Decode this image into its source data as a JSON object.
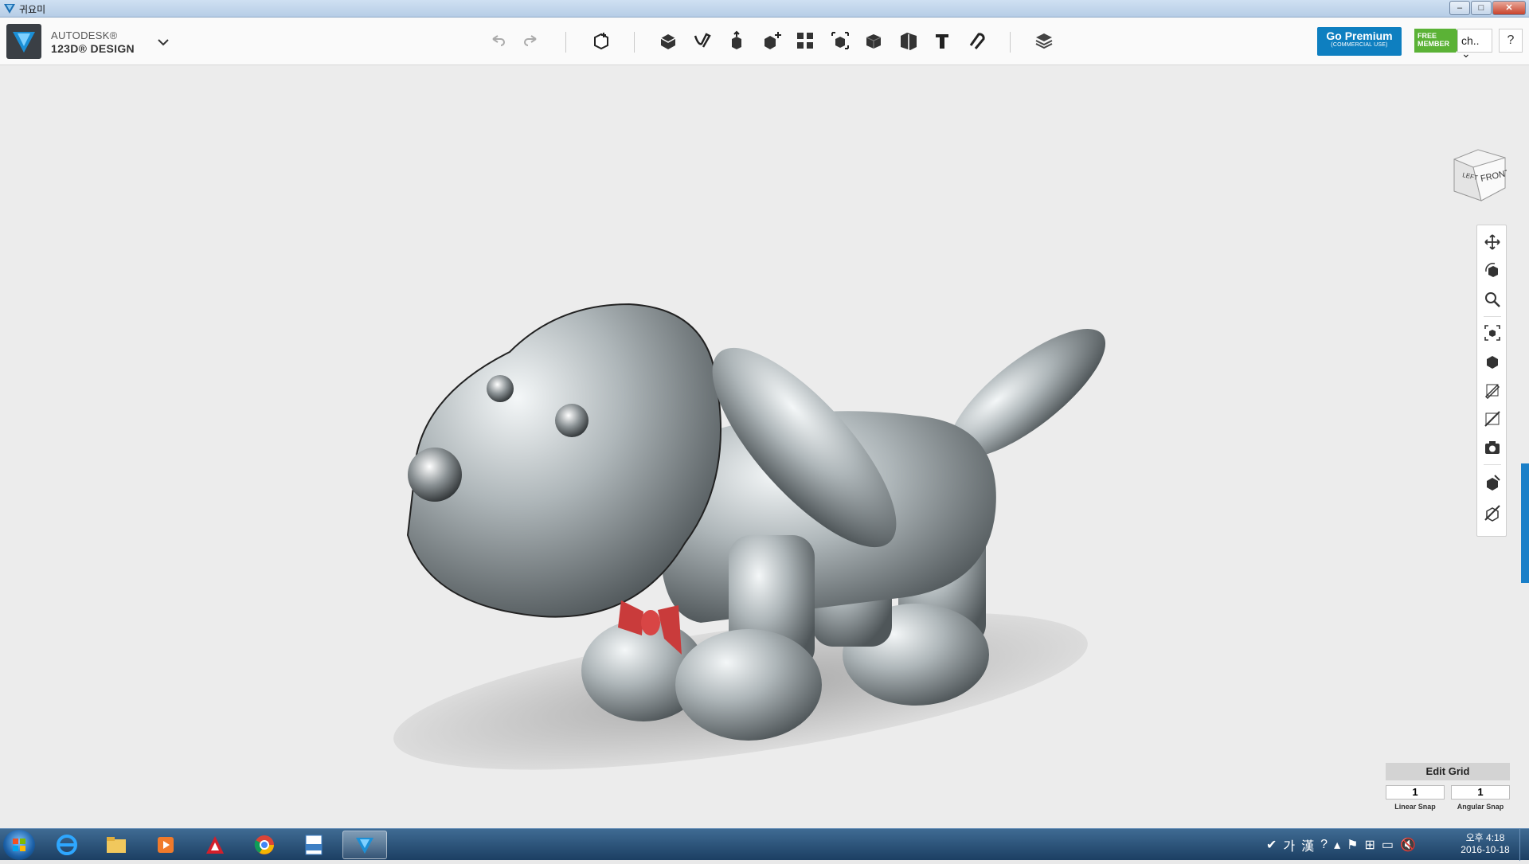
{
  "window": {
    "title": "귀요미",
    "min_label": "–",
    "max_label": "□",
    "close_label": "✕"
  },
  "app": {
    "brand_line1": "AUTODESK®",
    "brand_line2": "123D® DESIGN"
  },
  "toolbar": {
    "tools": [
      "undo-icon",
      "redo-icon",
      "primitives-icon",
      "sketch-icon",
      "construct-icon",
      "modify-icon",
      "pattern-icon",
      "group-icon",
      "combine-icon",
      "measure-icon",
      "text-icon",
      "snap-icon",
      "material-icon"
    ]
  },
  "premium": {
    "label": "Go Premium",
    "sublabel": "(COMMERCIAL USE)"
  },
  "member": {
    "badge_line1": "FREE",
    "badge_line2": "MEMBER",
    "user": "ch..",
    "chevron": "⌄"
  },
  "help": {
    "label": "?"
  },
  "viewcube": {
    "faces": [
      "LEFT",
      "FRONT"
    ]
  },
  "nav": {
    "items": [
      "pan-icon",
      "orbit-icon",
      "zoom-icon",
      "fit-icon",
      "views-icon",
      "visibility-icon",
      "hide-sketch-icon",
      "screenshot-icon",
      "material-display-icon",
      "outline-icon"
    ]
  },
  "grid": {
    "title": "Edit Grid",
    "linear_snap": "1",
    "angular_snap": "1",
    "linear_label": "Linear Snap",
    "angular_label": "Angular Snap"
  },
  "taskbar": {
    "apps": [
      "ie-icon",
      "explorer-icon",
      "media-player-icon",
      "autocad-icon",
      "chrome-icon",
      "pdf-icon",
      "123d-design-icon"
    ],
    "tray": {
      "ime1": "가",
      "ime2": "漢"
    },
    "clock": {
      "time": "오후 4:18",
      "date": "2016-10-18"
    }
  },
  "colors": {
    "accent": "#0e7fc0",
    "free_badge": "#5bb236",
    "model_body": "#aab2b5",
    "bow": "#c93b3b"
  }
}
